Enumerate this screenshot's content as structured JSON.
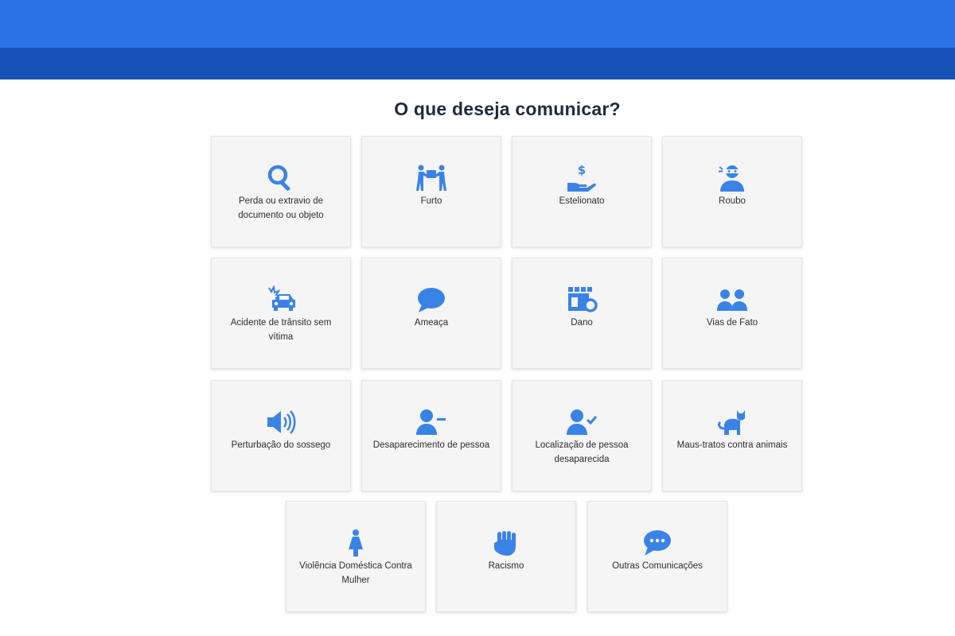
{
  "header": {
    "primary_color": "#2a72e6",
    "secondary_color": "#1652b8"
  },
  "page": {
    "title": "O que deseja comunicar?"
  },
  "options": [
    {
      "label": "Perda ou extravio de documento ou objeto",
      "icon": "search-icon"
    },
    {
      "label": "Furto",
      "icon": "people-carrying-box-icon"
    },
    {
      "label": "Estelionato",
      "icon": "hand-dollar-icon"
    },
    {
      "label": "Roubo",
      "icon": "masked-robber-icon"
    },
    {
      "label": "Acidente de trânsito sem vítima",
      "icon": "car-crash-icon"
    },
    {
      "label": "Ameaça",
      "icon": "speech-bubble-icon"
    },
    {
      "label": "Dano",
      "icon": "broken-storefront-icon"
    },
    {
      "label": "Vias de Fato",
      "icon": "two-people-icon"
    },
    {
      "label": "Perturbação do sossego",
      "icon": "loudspeaker-icon"
    },
    {
      "label": "Desaparecimento de pessoa",
      "icon": "person-minus-icon"
    },
    {
      "label": "Localização de pessoa desaparecida",
      "icon": "person-check-icon"
    },
    {
      "label": "Maus-tratos contra animais",
      "icon": "cat-icon"
    },
    {
      "label": "Violência Doméstica Contra Mulher",
      "icon": "woman-icon"
    },
    {
      "label": "Racismo",
      "icon": "raised-fist-icon"
    },
    {
      "label": "Outras Comunicações",
      "icon": "chat-dots-icon"
    }
  ]
}
